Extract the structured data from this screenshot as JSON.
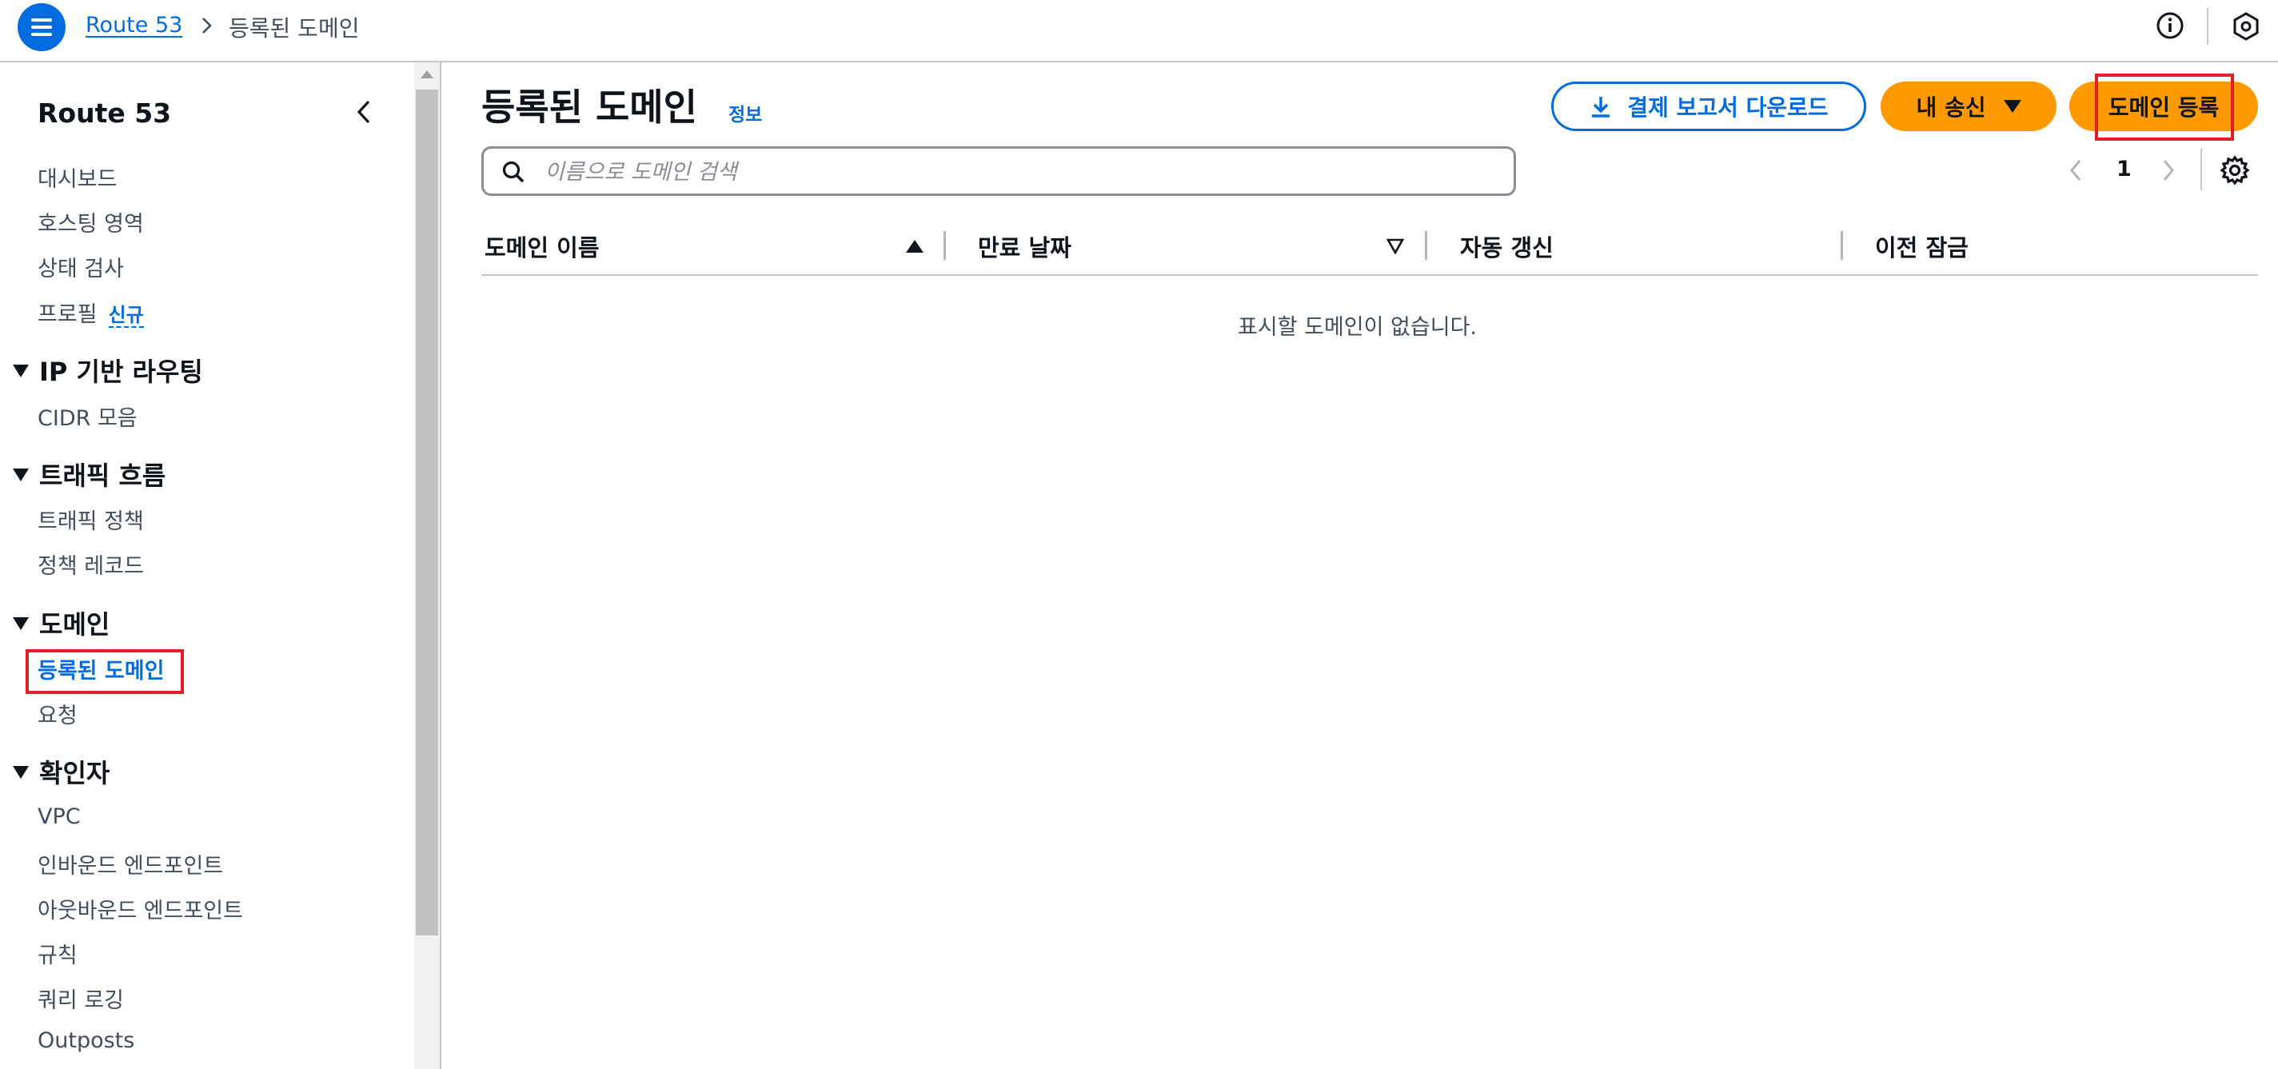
{
  "topbar": {
    "breadcrumb_service": "Route 53",
    "breadcrumb_current": "등록된 도메인"
  },
  "sidebar": {
    "title": "Route 53",
    "items_top": [
      "대시보드",
      "호스팅 영역",
      "상태 검사"
    ],
    "profiles_label": "프로필",
    "new_badge": "신규",
    "sections": [
      {
        "title": "IP 기반 라우팅",
        "items": [
          "CIDR 모음"
        ]
      },
      {
        "title": "트래픽 흐름",
        "items": [
          "트래픽 정책",
          "정책 레코드"
        ]
      },
      {
        "title": "도메인",
        "items": [
          "등록된 도메인",
          "요청"
        ]
      },
      {
        "title": "확인자",
        "items": [
          "VPC",
          "인바운드 엔드포인트",
          "아웃바운드 엔드포인트",
          "규칙",
          "쿼리 로깅",
          "Outposts"
        ]
      }
    ]
  },
  "main": {
    "title": "등록된 도메인",
    "info_link": "정보",
    "buttons": {
      "download_report": "결제 보고서 다운로드",
      "my_transfers": "내 송신",
      "register_domain": "도메인 등록"
    },
    "search_placeholder": "이름으로 도메인 검색",
    "pagination": {
      "current_page": "1"
    },
    "table": {
      "columns": [
        "도메인 이름",
        "만료 날짜",
        "자동 갱신",
        "이전 잠금"
      ],
      "empty_message": "표시할 도메인이 없습니다."
    }
  },
  "colors": {
    "primary_blue": "#006ce0",
    "orange": "#ff9900",
    "highlight_red": "#e11d2a",
    "border_gray": "#c6c6cd"
  }
}
